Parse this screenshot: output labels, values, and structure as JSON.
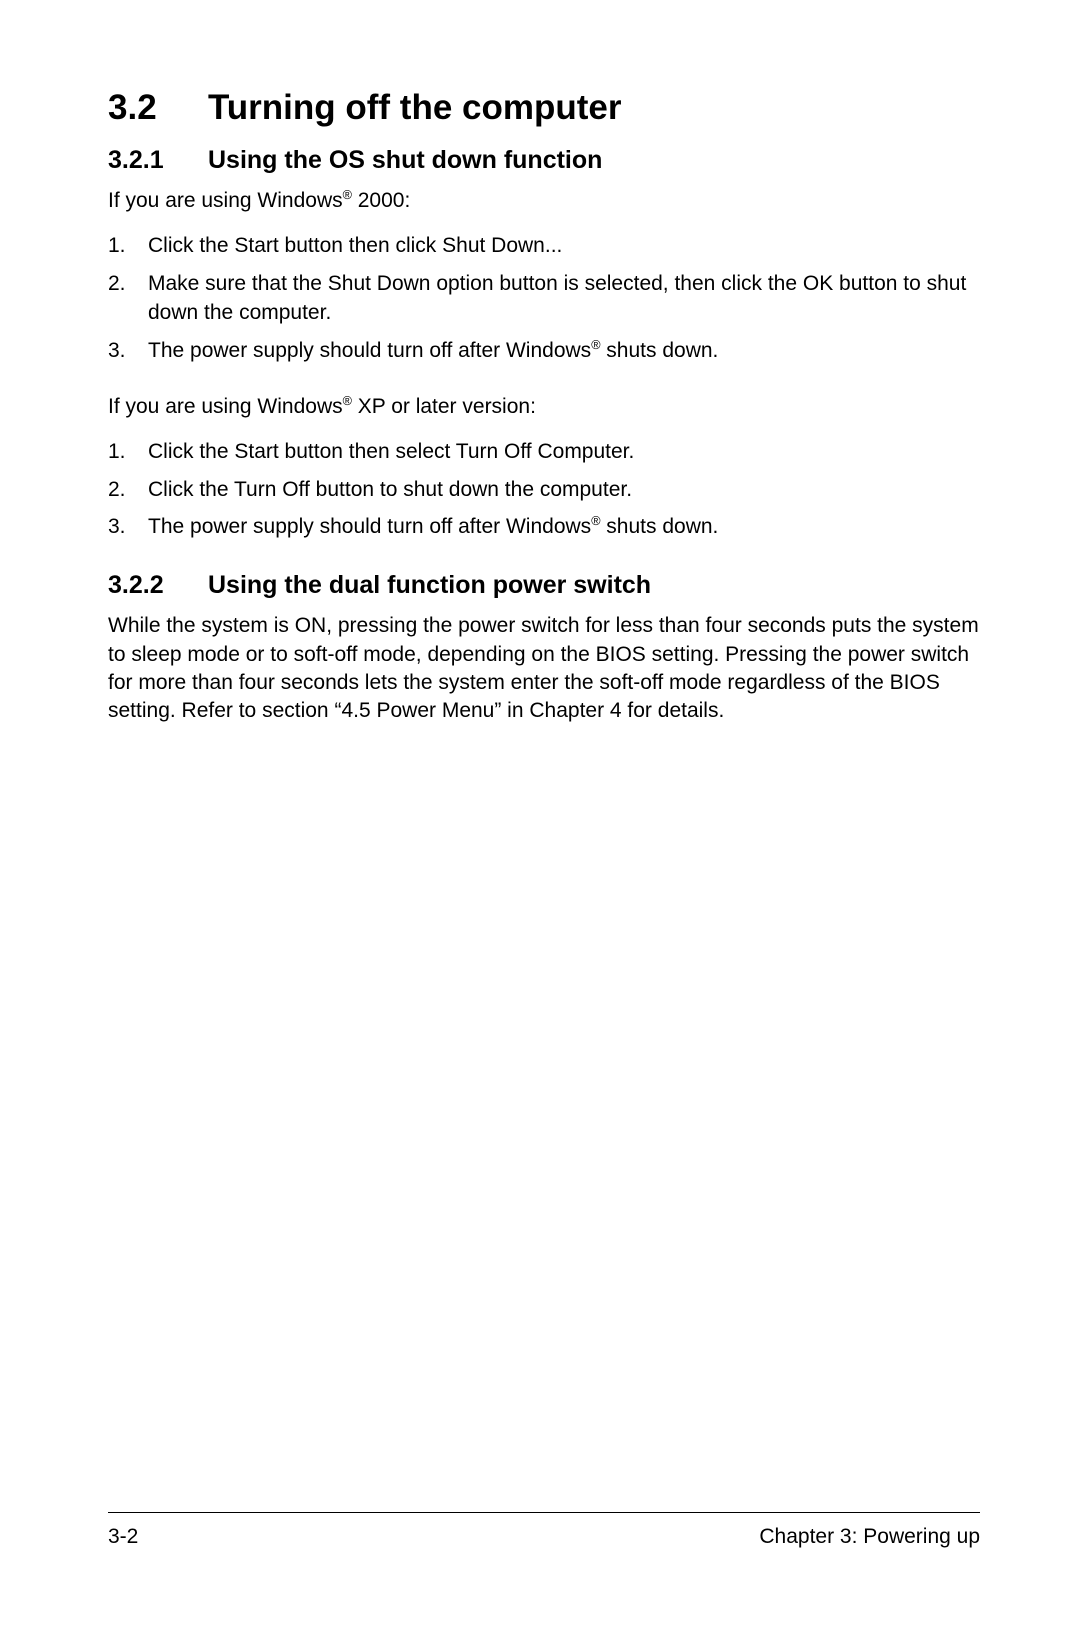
{
  "section": {
    "number": "3.2",
    "title": "Turning off the computer"
  },
  "sub1": {
    "number": "3.2.1",
    "title": "Using the OS shut down function",
    "intro1_a": "If you are using Windows",
    "intro1_b": " 2000:",
    "steps1": [
      "Click the Start button then click Shut Down...",
      "Make sure that the Shut Down option button is selected, then click the OK button to shut down the computer.",
      "The power supply should turn off after Windows® shuts down."
    ],
    "intro2_a": "If you are using Windows",
    "intro2_b": " XP or later version:",
    "steps2": [
      "Click the Start button then select Turn Off Computer.",
      "Click the Turn Off button to shut down the computer.",
      "The power supply should turn off after Windows® shuts down."
    ]
  },
  "sub2": {
    "number": "3.2.2",
    "title": "Using the dual function power switch",
    "para": "While the system is ON, pressing the power switch for less than four seconds puts the system to sleep mode or to soft-off mode, depending on the BIOS setting. Pressing the power switch for more than four seconds lets the system enter the soft-off mode regardless of the BIOS setting. Refer to section  “4.5  Power Menu” in Chapter 4 for details."
  },
  "footer": {
    "page": "3-2",
    "chapter": "Chapter 3: Powering up"
  },
  "reg": "®"
}
